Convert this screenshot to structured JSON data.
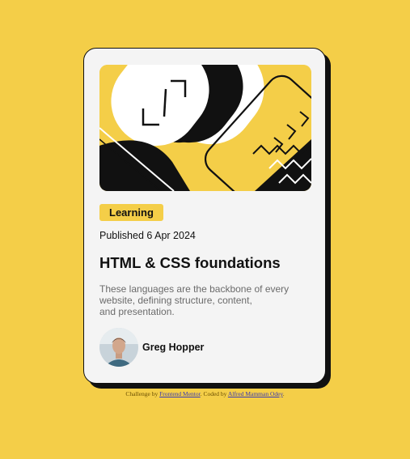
{
  "card": {
    "badge": "Learning",
    "published": "Published 6 Apr 2024",
    "title": "HTML & CSS foundations",
    "description": [
      "These languages are the backbone of every",
      "website, defining structure, content,",
      "and presentation."
    ],
    "author": {
      "name": "Greg Hopper",
      "avatar": "person-photo"
    },
    "hero_illustration": "abstract-geometric-illustration"
  },
  "attribution": {
    "prefix": "Challenge by ",
    "link1": "Frontend Mentor",
    "middle": ". Coded by ",
    "link2": "Alfred Mamman Odey",
    "suffix": "."
  },
  "colors": {
    "background": "#F4CE48",
    "card": "#F4F4F4",
    "ink": "#111111",
    "muted": "#6B6B6B"
  }
}
